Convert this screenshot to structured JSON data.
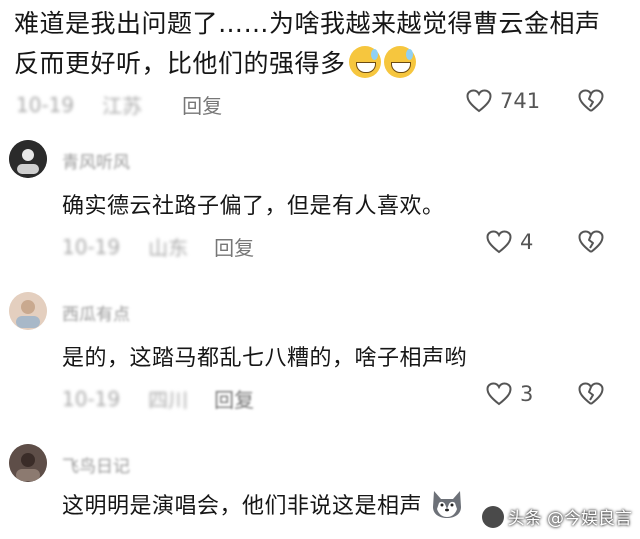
{
  "top_comment": {
    "text": "难道是我出问题了……为啥我越来越觉得曹云金相声反而更好听，比他们的强得多",
    "emoji": [
      "grinning-sweat-emoji",
      "grinning-sweat-emoji"
    ],
    "date": "10-19",
    "location": "江苏",
    "reply_label": "回复",
    "likes": "741"
  },
  "replies": [
    {
      "username": "青风听风",
      "text": "确实德云社路子偏了，但是有人喜欢。",
      "date": "10-19",
      "location": "山东",
      "reply_label": "回复",
      "likes": "4"
    },
    {
      "username": "西瓜有点",
      "text": "是的，这踏马都乱七八糟的，啥子相声哟",
      "date": "10-19",
      "location": "四川",
      "reply_label": "回复",
      "likes": "3"
    },
    {
      "username": "飞鸟日记",
      "text": "这明明是演唱会，他们非说这是相声",
      "emoji": "husky-emoji"
    }
  ],
  "watermark": "头条 @今娱良言",
  "colors": {
    "text": "#161616",
    "meta": "#777777",
    "icon": "#555555"
  }
}
